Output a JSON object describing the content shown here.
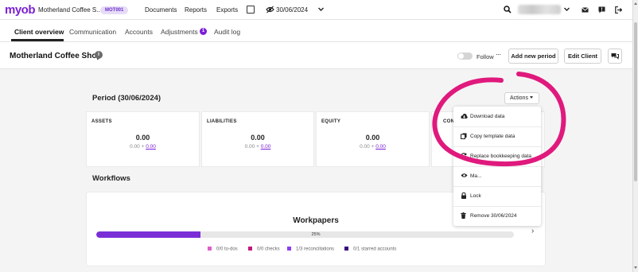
{
  "topnav": {
    "logo": "myob",
    "client_name": "Motherland Coffee S...",
    "client_code": "MOT001",
    "links": [
      "Documents",
      "Reports",
      "Exports"
    ],
    "date": "30/06/2024"
  },
  "tabs": [
    {
      "label": "Client overview",
      "active": true
    },
    {
      "label": "Communication"
    },
    {
      "label": "Accounts"
    },
    {
      "label": "Adjustments",
      "badge": "1"
    },
    {
      "label": "Audit log"
    }
  ],
  "header": {
    "title": "Motherland Coffee Shop",
    "follow_label": "Follow",
    "more_label": "···",
    "add_period_label": "Add new period",
    "edit_client_label": "Edit Client"
  },
  "period": {
    "title": "Period (30/06/2024)",
    "actions_label": "Actions",
    "stats": [
      {
        "label": "ASSETS",
        "value": "0.00",
        "sub_base": "0.00",
        "sub_plus": "+",
        "sub_link": "0.00"
      },
      {
        "label": "LIABILITIES",
        "value": "0.00",
        "sub_base": "0.00",
        "sub_plus": "+",
        "sub_link": "0.00"
      },
      {
        "label": "EQUITY",
        "value": "0.00",
        "sub_base": "0.00",
        "sub_plus": "+",
        "sub_link": "0.00"
      },
      {
        "label": "CON",
        "value": "",
        "sub_base": "",
        "sub_plus": "",
        "sub_link": ""
      }
    ]
  },
  "workflows": {
    "title": "Workflows",
    "workpapers_title": "Workpapers",
    "progress": 0.25,
    "progress_label": "25%",
    "legend": [
      {
        "label": "0/0 to-dos",
        "color": "#e05fc7"
      },
      {
        "label": "0/0 checks",
        "color": "#c2187f"
      },
      {
        "label": "1/3 reconciliations",
        "color": "#8a3ff0"
      },
      {
        "label": "0/1 starred accounts",
        "color": "#3a0a7d"
      }
    ],
    "next_label": "›"
  },
  "actions_menu": {
    "items": [
      {
        "label": "Download data",
        "icon": "cloud-download-icon"
      },
      {
        "label": "Copy template data",
        "icon": "copy-icon"
      },
      {
        "label": "Replace bookkeeping data",
        "icon": "refresh-icon"
      },
      {
        "label": "Ma...",
        "icon": "eye-icon"
      },
      {
        "label": "Lock",
        "icon": "lock-icon"
      },
      {
        "label": "Remove 30/06/2024",
        "icon": "trash-icon"
      }
    ]
  },
  "colors": {
    "brand": "#7b1fd6",
    "highlight": "#e0197d",
    "progress": "#7a2fd6"
  }
}
